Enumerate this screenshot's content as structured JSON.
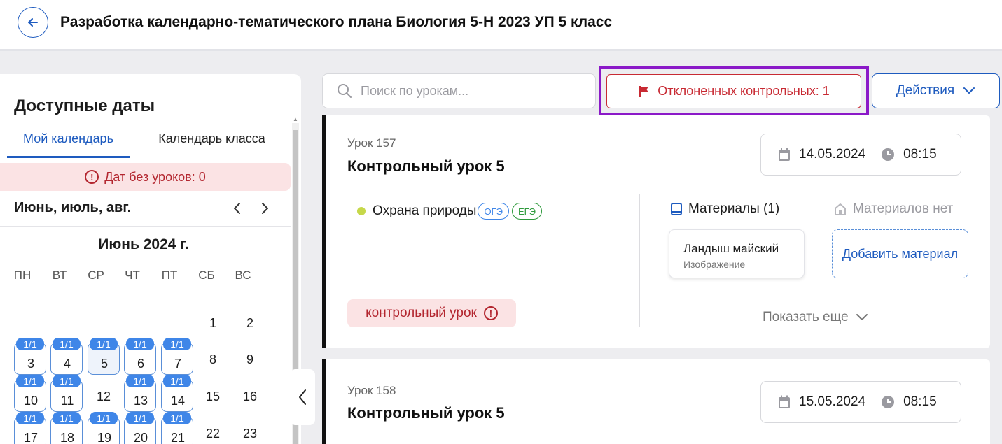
{
  "header": {
    "title": "Разработка календарно-тематического плана Биология 5-Н 2023 УП 5 класс"
  },
  "left_panel": {
    "title": "Доступные даты",
    "tabs": [
      {
        "label": "Мой календарь",
        "active": true
      },
      {
        "label": "Календарь класса",
        "active": false
      }
    ],
    "alert": "Дат без уроков: 0",
    "months_label": "Июнь, июль, авг.",
    "calendar": {
      "month_title": "Июнь 2024 г.",
      "weekdays": [
        "ПН",
        "ВТ",
        "СР",
        "ЧТ",
        "ПТ",
        "СБ",
        "ВС"
      ],
      "days": [
        {
          "num": "1",
          "badge": ""
        },
        {
          "num": "2",
          "badge": ""
        },
        {
          "num": "3",
          "badge": "1/1"
        },
        {
          "num": "4",
          "badge": "1/1"
        },
        {
          "num": "5",
          "badge": "1/1"
        },
        {
          "num": "6",
          "badge": "1/1"
        },
        {
          "num": "7",
          "badge": "1/1"
        },
        {
          "num": "8",
          "badge": ""
        },
        {
          "num": "9",
          "badge": ""
        },
        {
          "num": "10",
          "badge": "1/1"
        },
        {
          "num": "11",
          "badge": "1/1"
        },
        {
          "num": "12",
          "badge": ""
        },
        {
          "num": "13",
          "badge": "1/1"
        },
        {
          "num": "14",
          "badge": "1/1"
        },
        {
          "num": "15",
          "badge": ""
        },
        {
          "num": "16",
          "badge": ""
        },
        {
          "num": "17",
          "badge": "1/1"
        },
        {
          "num": "18",
          "badge": "1/1"
        },
        {
          "num": "19",
          "badge": "1/1"
        },
        {
          "num": "20",
          "badge": "1/1"
        },
        {
          "num": "21",
          "badge": "1/1"
        },
        {
          "num": "22",
          "badge": ""
        },
        {
          "num": "23",
          "badge": ""
        }
      ]
    }
  },
  "toolbar": {
    "search_placeholder": "Поиск по урокам...",
    "rejected_label": "Отклоненных контрольных: 1",
    "actions_label": "Действия"
  },
  "lessons": [
    {
      "number": "Урок 157",
      "title": "Контрольный урок 5",
      "date": "14.05.2024",
      "time": "08:15",
      "topic": "Охрана природы",
      "tags": [
        "ОГЭ",
        "ЕГЭ"
      ],
      "kind": "контрольный урок",
      "materials_label": "Материалы (1)",
      "no_materials_label": "Материалов нет",
      "material": {
        "name": "Ландыш майский",
        "type": "Изображение"
      },
      "add_material_label": "Добавить материал",
      "show_more_label": "Показать еще"
    },
    {
      "number": "Урок 158",
      "title": "Контрольный урок 5",
      "date": "15.05.2024",
      "time": "08:15"
    }
  ],
  "colors": {
    "accent": "#1e5bbf",
    "danger": "#c82a33",
    "highlight": "#8b19c8",
    "badge": "#3f86e8"
  }
}
